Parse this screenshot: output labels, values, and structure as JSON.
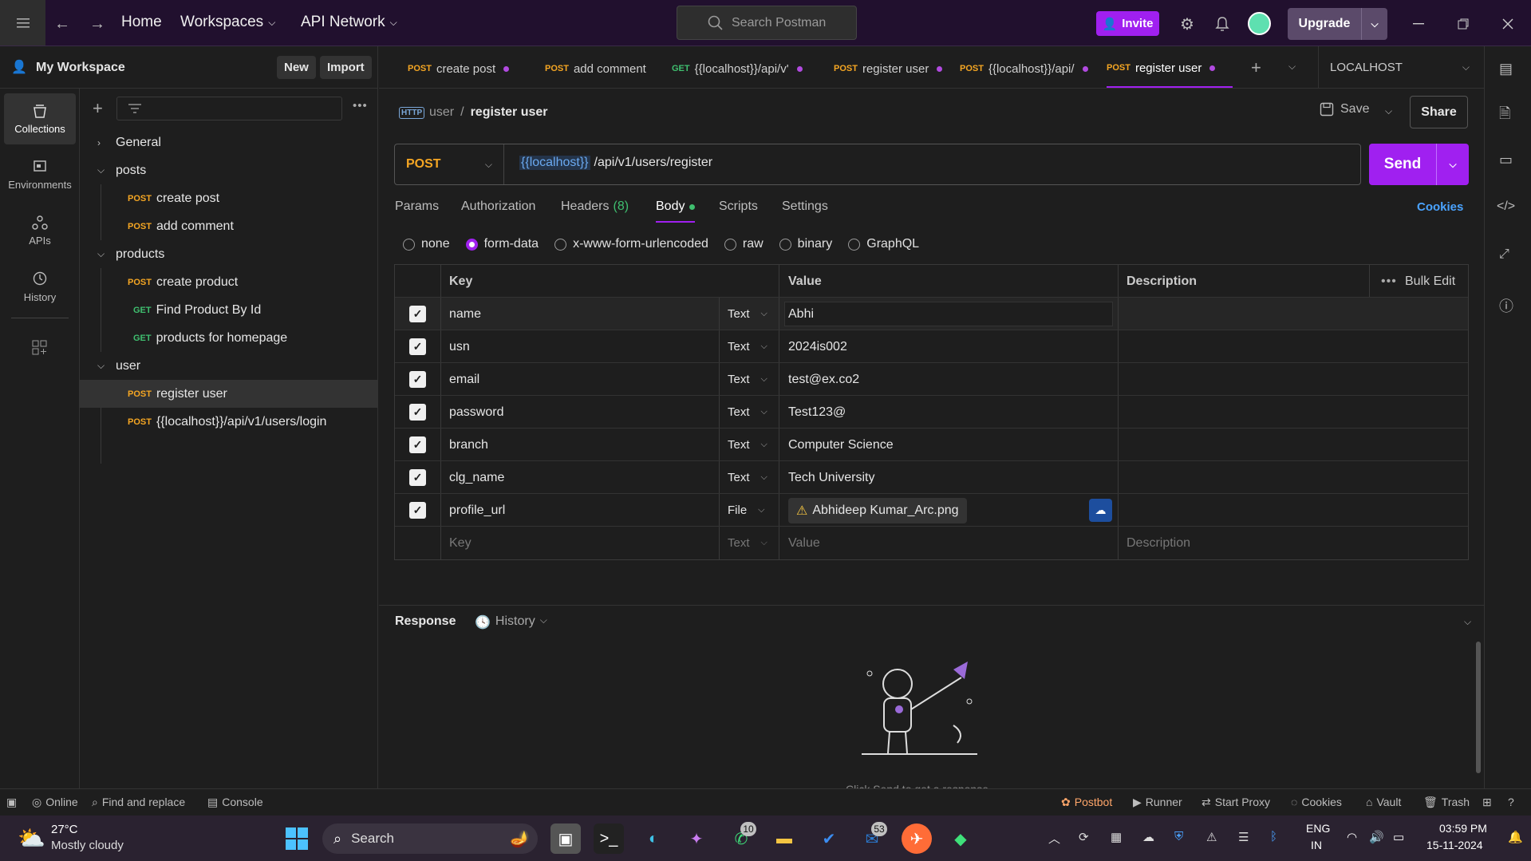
{
  "topbar": {
    "nav_home": "Home",
    "nav_workspaces": "Workspaces",
    "nav_api_network": "API Network",
    "search_placeholder": "Search Postman",
    "invite": "Invite",
    "upgrade": "Upgrade"
  },
  "sidebar": {
    "workspace_name": "My Workspace",
    "new_btn": "New",
    "import_btn": "Import",
    "rail": [
      "Collections",
      "Environments",
      "APIs",
      "History"
    ],
    "tree": [
      {
        "kind": "folder",
        "label": "General",
        "expanded": false
      },
      {
        "kind": "folder",
        "label": "posts",
        "expanded": true
      },
      {
        "kind": "req",
        "method": "POST",
        "label": "create post"
      },
      {
        "kind": "req",
        "method": "POST",
        "label": "add comment"
      },
      {
        "kind": "folder",
        "label": "products",
        "expanded": true
      },
      {
        "kind": "req",
        "method": "POST",
        "label": "create product"
      },
      {
        "kind": "req",
        "method": "GET",
        "label": "Find Product By Id"
      },
      {
        "kind": "req",
        "method": "GET",
        "label": "products for homepage"
      },
      {
        "kind": "folder",
        "label": "user",
        "expanded": true
      },
      {
        "kind": "req",
        "method": "POST",
        "label": "register user",
        "selected": true
      },
      {
        "kind": "req",
        "method": "POST",
        "label": "{{localhost}}/api/v1/users/login"
      }
    ]
  },
  "tabs": [
    {
      "method": "POST",
      "label": "create post",
      "dot": true
    },
    {
      "method": "POST",
      "label": "add comment",
      "dot": false
    },
    {
      "method": "GET",
      "label": "{{localhost}}/api/v'",
      "dot": true
    },
    {
      "method": "POST",
      "label": "register user",
      "dot": true
    },
    {
      "method": "POST",
      "label": "{{localhost}}/api/",
      "dot": true
    },
    {
      "method": "POST",
      "label": "register user",
      "dot": true,
      "active": true
    }
  ],
  "environment": "LOCALHOST",
  "request": {
    "breadcrumb_parent": "user",
    "breadcrumb_sep": "/",
    "breadcrumb_current": "register user",
    "save": "Save",
    "share": "Share",
    "method": "POST",
    "url_var": "{{localhost}}",
    "url_path": "/api/v1/users/register",
    "send": "Send",
    "subtabs": {
      "params": "Params",
      "authorization": "Authorization",
      "headers": "Headers",
      "headers_count": "(8)",
      "body": "Body",
      "scripts": "Scripts",
      "settings": "Settings"
    },
    "cookies": "Cookies",
    "body_types": [
      "none",
      "form-data",
      "x-www-form-urlencoded",
      "raw",
      "binary",
      "GraphQL"
    ],
    "body_selected": "form-data"
  },
  "form_table": {
    "headers": {
      "key": "Key",
      "value": "Value",
      "description": "Description",
      "bulk_edit": "Bulk Edit"
    },
    "rows": [
      {
        "key": "name",
        "type": "Text",
        "value": "Abhi"
      },
      {
        "key": "usn",
        "type": "Text",
        "value": "2024is002"
      },
      {
        "key": "email",
        "type": "Text",
        "value": "test@ex.co2"
      },
      {
        "key": "password",
        "type": "Text",
        "value": "Test123@"
      },
      {
        "key": "branch",
        "type": "Text",
        "value": "Computer Science"
      },
      {
        "key": "clg_name",
        "type": "Text",
        "value": "Tech University"
      },
      {
        "key": "profile_url",
        "type": "File",
        "value": "Abhideep Kumar_Arc.png"
      }
    ],
    "placeholder": {
      "key": "Key",
      "type": "Text",
      "value": "Value",
      "description": "Description"
    }
  },
  "response": {
    "label": "Response",
    "history": "History",
    "hint": "Click Send to get a response"
  },
  "statusbar": {
    "online": "Online",
    "find_replace": "Find and replace",
    "console": "Console",
    "postbot": "Postbot",
    "runner": "Runner",
    "start_proxy": "Start Proxy",
    "cookies": "Cookies",
    "vault": "Vault",
    "trash": "Trash"
  },
  "taskbar": {
    "temp": "27°C",
    "weather": "Mostly cloudy",
    "search": "Search",
    "whatsapp_badge": "10",
    "outlook_badge": "53",
    "lang1": "ENG",
    "lang2": "IN",
    "time": "03:59 PM",
    "date": "15-11-2024"
  },
  "colors": {
    "accent": "#a020f0",
    "post": "#f5a623",
    "get": "#3fbf6f",
    "titlebar": "#21102e"
  }
}
